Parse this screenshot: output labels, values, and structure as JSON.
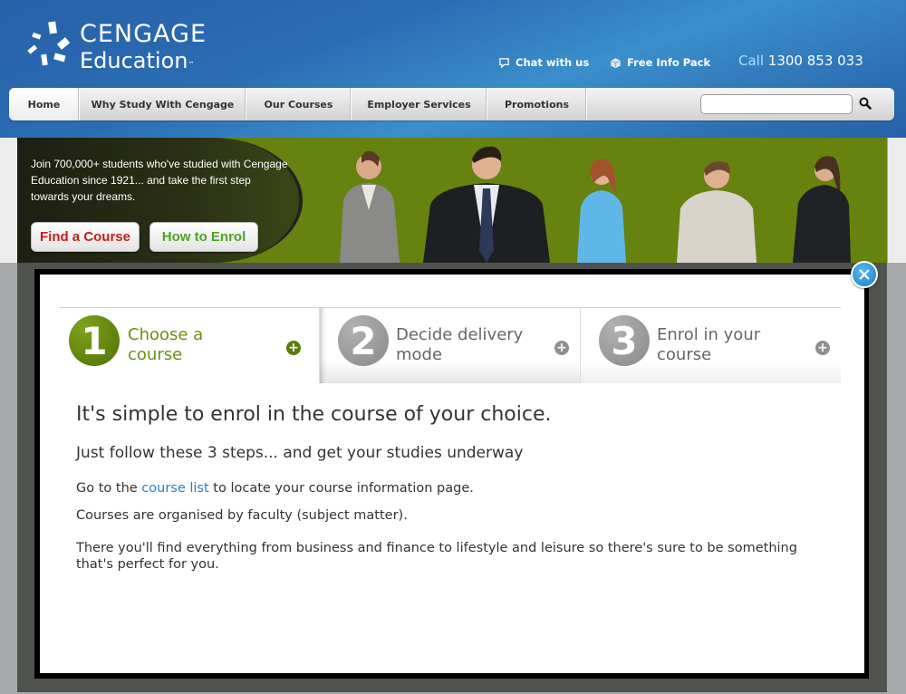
{
  "header": {
    "logo": {
      "line1": "CENGAGE",
      "line2": "Education",
      "tm": "™"
    },
    "links": [
      {
        "label": "Chat with us",
        "icon": "chat-bubble-icon"
      },
      {
        "label": "Free Info Pack",
        "icon": "box-icon"
      }
    ],
    "phone": {
      "prefix": "Call",
      "number": "1300 853 033"
    }
  },
  "nav": {
    "items": [
      {
        "label": "Home",
        "active": true
      },
      {
        "label": "Why Study With Cengage"
      },
      {
        "label": "Our Courses"
      },
      {
        "label": "Employer Services"
      },
      {
        "label": "Promotions"
      }
    ],
    "search": {
      "value": "",
      "placeholder": "",
      "button_icon": "search-icon"
    }
  },
  "banner": {
    "text": "Join 700,000+ students who've studied with Cengage Education since 1921... and take the first step towards your dreams.",
    "buttons": [
      {
        "label": "Find a Course"
      },
      {
        "label": "How to Enrol"
      }
    ]
  },
  "modal": {
    "close_icon": "close-x-icon",
    "steps": [
      {
        "number": "1",
        "label_line1": "Choose a",
        "label_line2": "course",
        "active": true
      },
      {
        "number": "2",
        "label_line1": "Decide delivery",
        "label_line2": "mode",
        "active": false
      },
      {
        "number": "3",
        "label_line1": "Enrol in your",
        "label_line2": "course",
        "active": false
      }
    ],
    "content": {
      "heading": "It's simple to enrol in the course of your choice.",
      "subheading": "Just follow these 3 steps... and get your studies underway",
      "p1_before": "Go to the ",
      "p1_link": "course list",
      "p1_after": " to locate your course information page.",
      "p2": "Courses are organised by faculty (subject matter).",
      "p3": "There you'll find everything from business and finance to lifestyle and leisure so there's sure to be something that's perfect for you."
    }
  },
  "colors": {
    "header_blue": "#2b6db3",
    "banner_green": "#66820f",
    "step_active_green": "#6b8e12",
    "link_blue": "#2a7fc5",
    "find_course_red": "#c0221c",
    "how_to_enrol_green": "#4da322",
    "overlay_grey": "#50524e"
  }
}
